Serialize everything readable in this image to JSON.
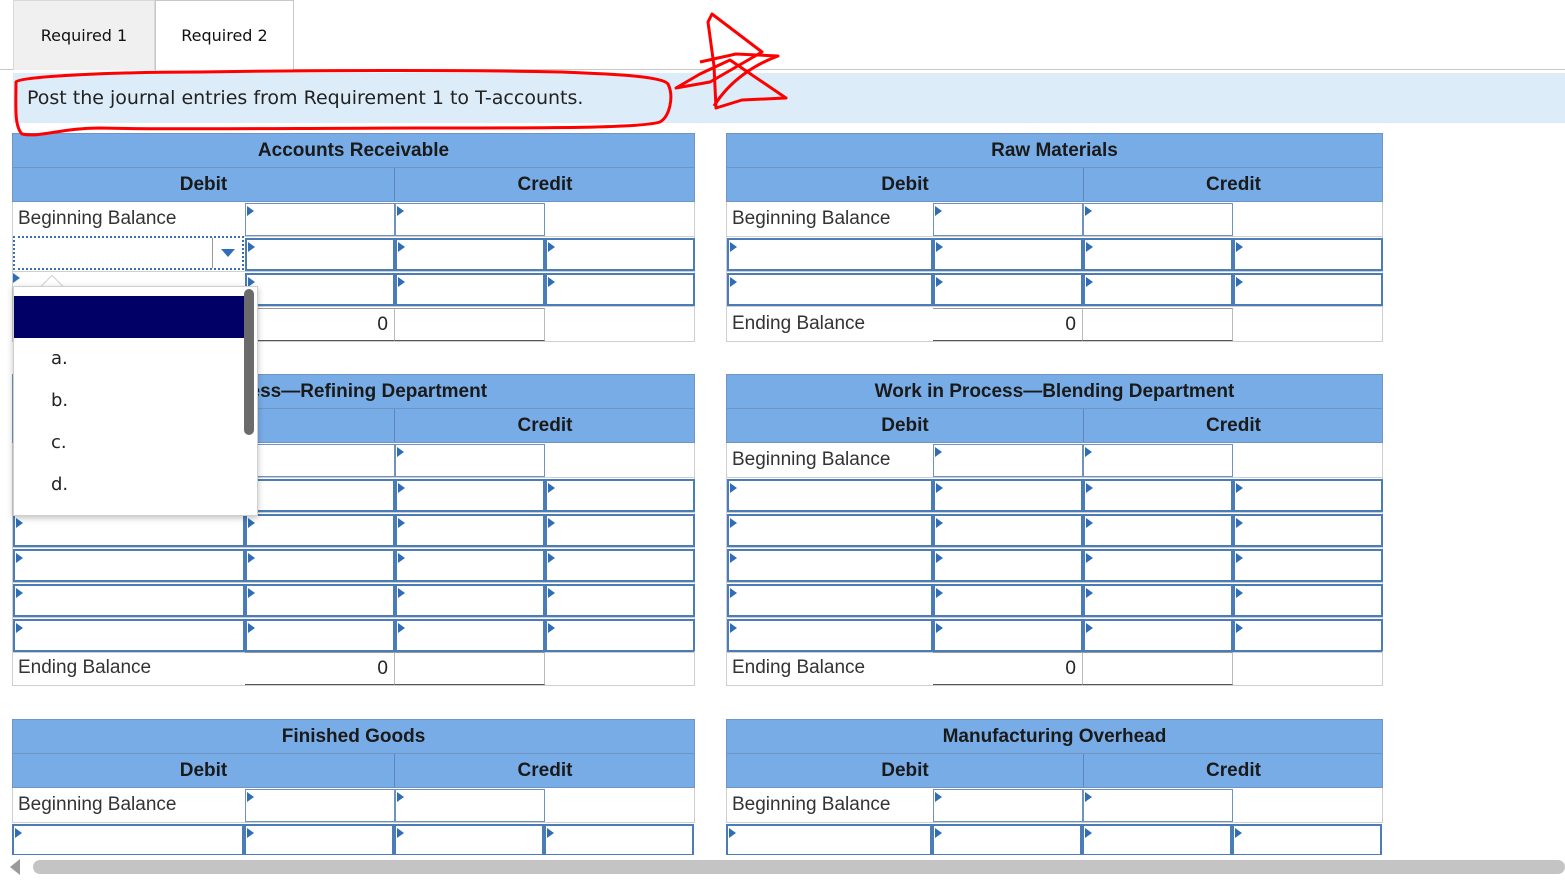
{
  "tabs": [
    {
      "label": "Required 1"
    },
    {
      "label": "Required 2"
    }
  ],
  "instruction": "Post the journal entries from Requirement 1 to T-accounts.",
  "labels": {
    "debit": "Debit",
    "credit": "Credit",
    "beginning_balance": "Beginning Balance",
    "ending_balance": "Ending Balance"
  },
  "accounts": [
    {
      "title": "Accounts Receivable",
      "ending_total": "0"
    },
    {
      "title": "Raw Materials",
      "ending_total": "0"
    },
    {
      "title": "Work in Process—Refining Department",
      "visible_title": "rocess—Refining Department",
      "ending_total": "0"
    },
    {
      "title": "Work in Process—Blending Department",
      "ending_total": "0"
    },
    {
      "title": "Finished Goods"
    },
    {
      "title": "Manufacturing Overhead"
    }
  ],
  "dropdown": {
    "selected": "",
    "options": [
      "a.",
      "b.",
      "c.",
      "d."
    ]
  },
  "colors": {
    "header_blue": "#78ace6",
    "instruction_bg": "#dcecf9",
    "input_border": "#4a7db8",
    "dropdown_selected": "#000066",
    "annotation_red": "#ff0000"
  }
}
